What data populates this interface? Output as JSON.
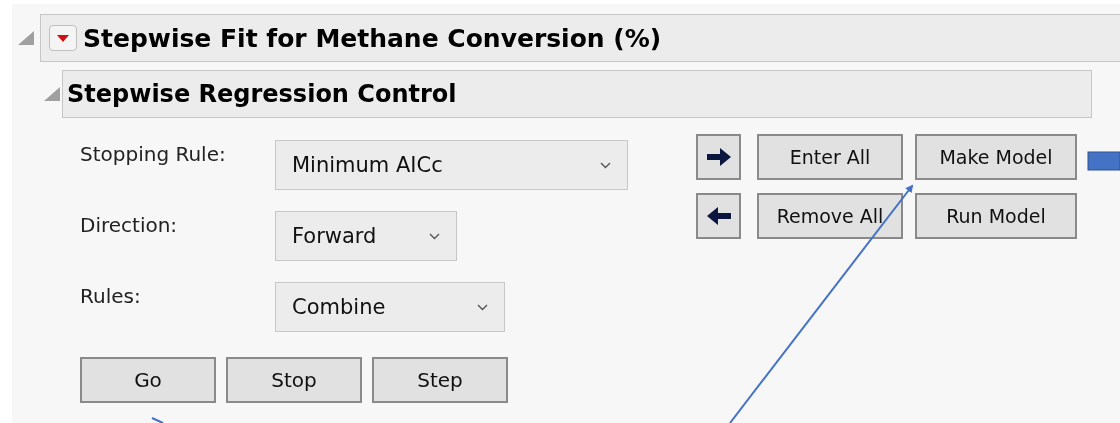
{
  "report": {
    "title": "Stepwise Fit for Methane Conversion (%)",
    "expanded": true
  },
  "control": {
    "title": "Stepwise Regression Control",
    "expanded": true,
    "settings": [
      {
        "label": "Stopping Rule:",
        "value": "Minimum AICc"
      },
      {
        "label": "Direction:",
        "value": "Forward"
      },
      {
        "label": "Rules:",
        "value": "Combine"
      }
    ],
    "run_buttons": [
      "Go",
      "Stop",
      "Step"
    ],
    "entry_rows": [
      {
        "kind": "enter",
        "buttons": [
          "Enter All",
          "Make Model"
        ]
      },
      {
        "kind": "remove",
        "buttons": [
          "Remove All",
          "Run Model"
        ]
      }
    ]
  }
}
